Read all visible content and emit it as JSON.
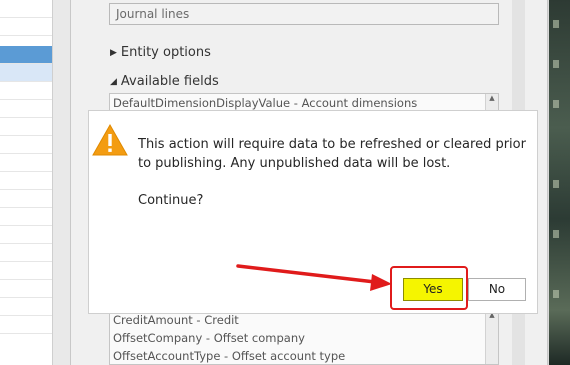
{
  "form": {
    "journal_value": "Journal lines",
    "entity_options_label": "Entity options",
    "available_fields_label": "Available fields",
    "available_fields_top": [
      "DefaultDimensionDisplayValue - Account dimensions"
    ],
    "available_fields_bottom": [
      "CreditAmount - Credit",
      "OffsetCompany - Offset company",
      "OffsetAccountType - Offset account type"
    ]
  },
  "dialog": {
    "icon": "warning-icon",
    "message": "This action will require data to be refreshed or cleared prior to publishing. Any unpublished data will be lost.",
    "question": "Continue?",
    "yes_label": "Yes",
    "no_label": "No"
  },
  "colors": {
    "yes_button_highlight": "#f5f500",
    "annotation_red": "#e01b1b",
    "warning_orange": "#f39c12"
  }
}
